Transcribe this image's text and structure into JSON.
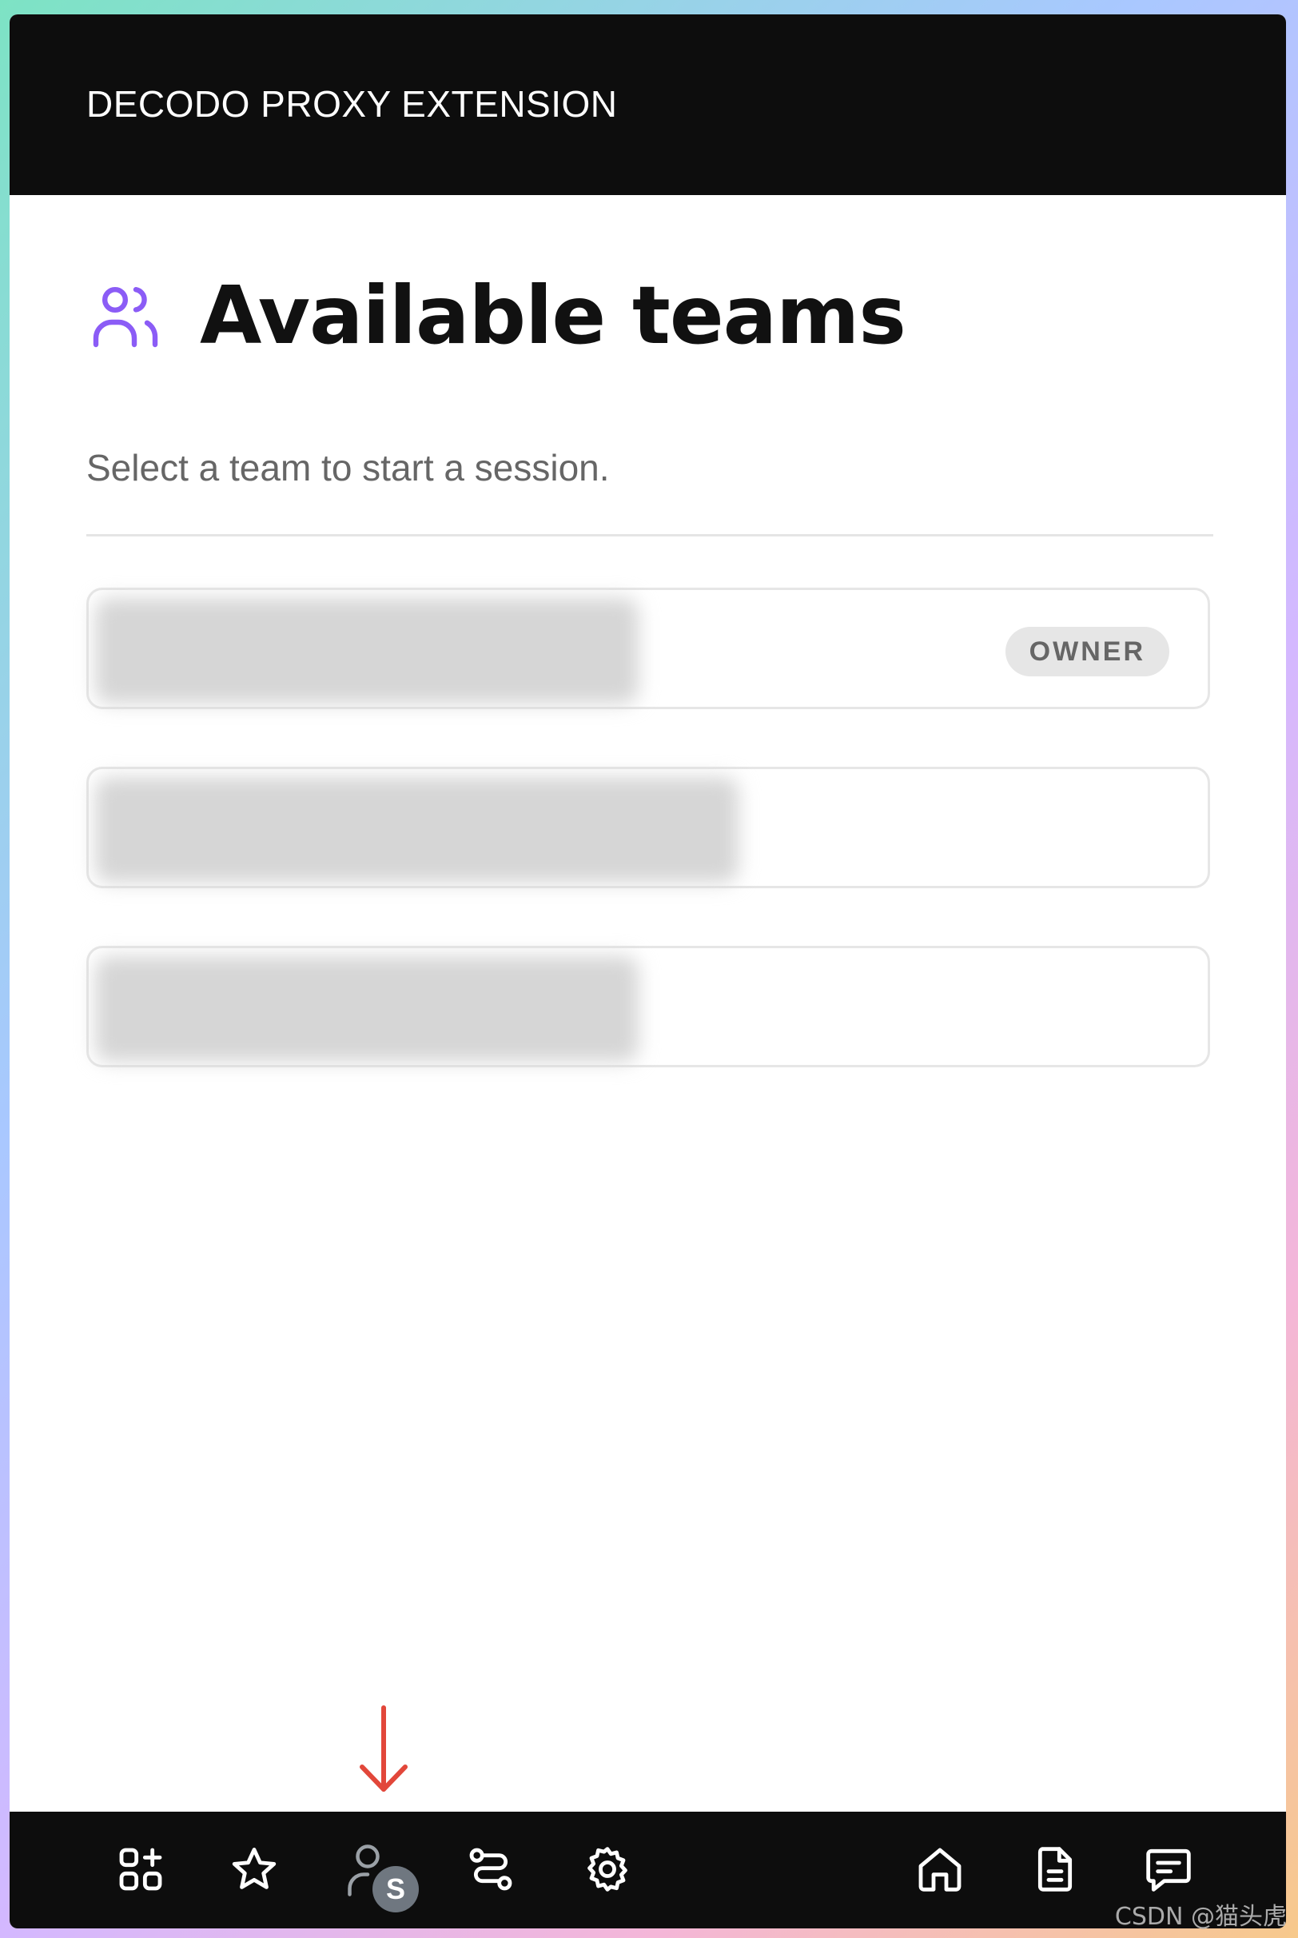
{
  "header": {
    "title": "DECODO PROXY EXTENSION"
  },
  "main": {
    "title": "Available teams",
    "subtitle": "Select a team to start a session.",
    "teams": [
      {
        "name": "",
        "badge": "OWNER"
      },
      {
        "name": ""
      },
      {
        "name": ""
      }
    ]
  },
  "bottom_nav": {
    "left": [
      "apps-add-icon",
      "star-icon",
      "user-session-icon",
      "route-icon",
      "gear-icon"
    ],
    "right": [
      "home-icon",
      "document-icon",
      "message-icon"
    ],
    "avatar_letter": "S"
  },
  "annotation": {
    "arrow_color": "#e2473a"
  },
  "colors": {
    "accent": "#8b5cf6",
    "bar": "#0d0d0d"
  },
  "watermark": "CSDN @猫头虎"
}
